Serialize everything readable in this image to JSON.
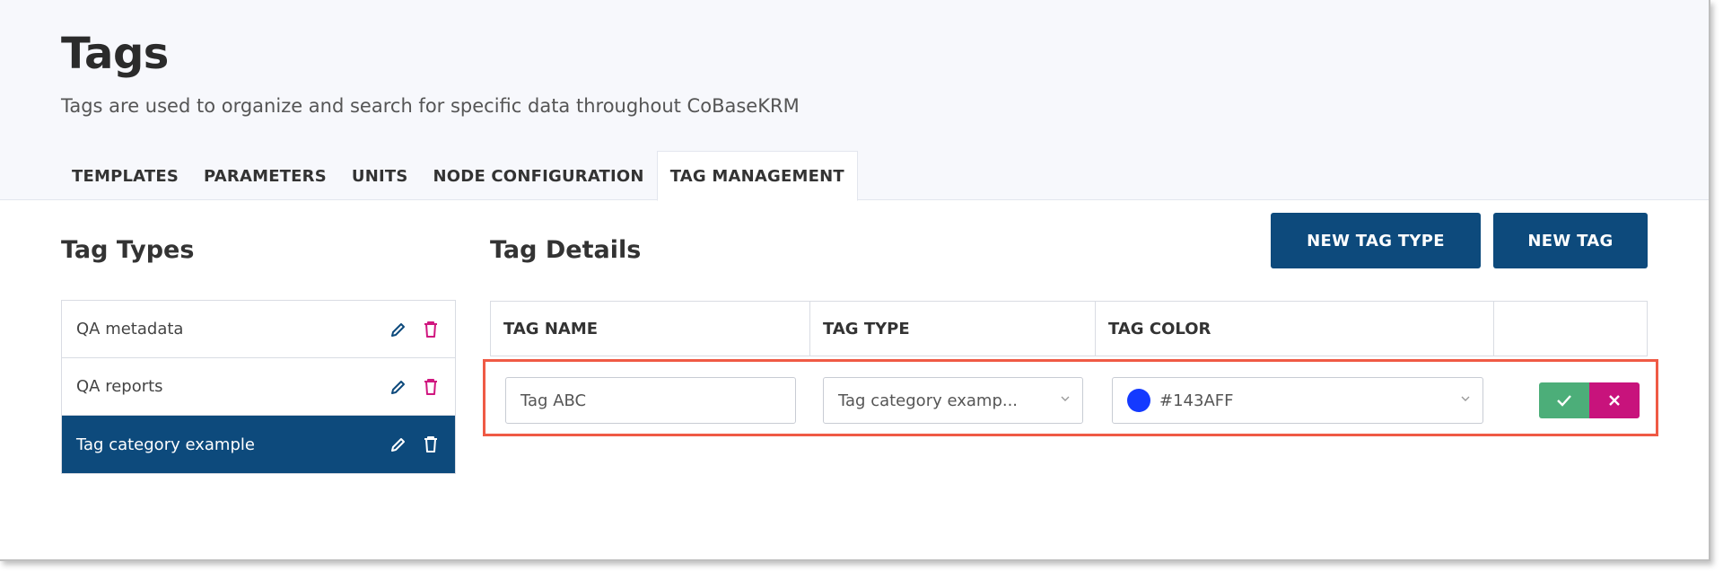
{
  "page": {
    "title": "Tags",
    "subtitle": "Tags are used to organize and search for specific data throughout CoBaseKRM"
  },
  "tabs": [
    {
      "label": "TEMPLATES",
      "active": false
    },
    {
      "label": "PARAMETERS",
      "active": false
    },
    {
      "label": "UNITS",
      "active": false
    },
    {
      "label": "NODE CONFIGURATION",
      "active": false
    },
    {
      "label": "TAG MANAGEMENT",
      "active": true
    }
  ],
  "tag_types": {
    "title": "Tag Types",
    "items": [
      {
        "label": "QA metadata",
        "selected": false
      },
      {
        "label": "QA reports",
        "selected": false
      },
      {
        "label": "Tag category example",
        "selected": true
      }
    ]
  },
  "tag_details": {
    "title": "Tag Details",
    "columns": [
      "TAG NAME",
      "TAG TYPE",
      "TAG COLOR",
      ""
    ],
    "edit_row": {
      "name_value": "Tag ABC",
      "type_value": "Tag category examp...",
      "color_value": "#143AFF"
    }
  },
  "buttons": {
    "new_tag_type": "NEW TAG TYPE",
    "new_tag": "NEW TAG"
  },
  "colors": {
    "primary": "#0d4a7c",
    "confirm": "#4cae79",
    "cancel": "#c8137c",
    "delete_icon": "#d0167f",
    "highlight": "#ef5a45",
    "tag_color_swatch": "#143AFF"
  }
}
